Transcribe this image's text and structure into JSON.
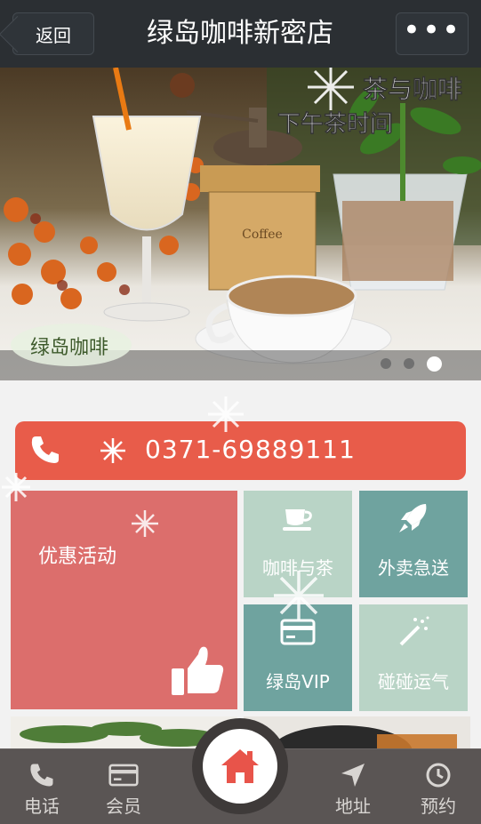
{
  "header": {
    "back_label": "返回",
    "title": "绿岛咖啡新密店",
    "more_label": "•••"
  },
  "banner": {
    "headline_1": "茶与咖啡",
    "headline_2": "下午茶时间",
    "coffee_box_label": "Coffee",
    "logo_text": "绿岛咖啡",
    "slide_count": 3,
    "active_slide": 3
  },
  "phone": {
    "number": "0371-69889111",
    "icon": "phone-icon"
  },
  "tiles": {
    "promo": {
      "label": "优惠活动",
      "icon": "thumbs-up-icon"
    },
    "items": [
      {
        "label": "咖啡与茶",
        "icon": "coffee-cup-icon"
      },
      {
        "label": "外卖急送",
        "icon": "rocket-icon"
      },
      {
        "label": "绿岛VIP",
        "icon": "card-icon"
      },
      {
        "label": "碰碰运气",
        "icon": "magic-wand-icon"
      }
    ]
  },
  "nav": {
    "call_label": "电话",
    "member_label": "会员",
    "home_icon": "home-icon",
    "address_label": "地址",
    "booking_label": "预约"
  },
  "colors": {
    "topbar": "#2b2f33",
    "phone_bar": "#e85c4a",
    "promo_tile": "#dc6e6c",
    "teal_light": "#b9d4c6",
    "teal_dark": "#6fa39f",
    "navbar": "#5a5554",
    "home_accent": "#e8544a"
  }
}
